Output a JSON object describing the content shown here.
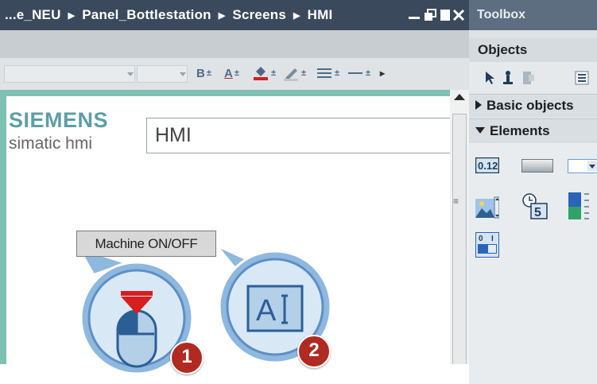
{
  "editor": {
    "breadcrumb": [
      "...e_NEU",
      "Panel_Bottlestation",
      "Screens",
      "HMI"
    ],
    "window_controls": [
      "minimize",
      "restore",
      "maximize",
      "close"
    ]
  },
  "format_toolbar": {
    "bold_label": "B",
    "font_color_label": "A",
    "overflow_glyph": "▸"
  },
  "screen": {
    "logo_text": "SIEMENS",
    "subtitle": "simatic hmi",
    "title_field_value": "HMI",
    "button_label": "Machine ON/OFF"
  },
  "callouts": [
    {
      "number": "1",
      "icon": "mouse-icon"
    },
    {
      "number": "2",
      "icon": "text-field-icon"
    }
  ],
  "toolbox": {
    "title": "Toolbox",
    "objects_header": "Objects",
    "basic_objects": "Basic objects",
    "elements": "Elements",
    "elements_items": [
      "io-field-icon",
      "button-icon",
      "symbolic-io-field-icon",
      "graphic-io-field-icon",
      "date-time-field-icon",
      "bar-icon",
      "switch-icon"
    ],
    "io_field_label": "0.12",
    "clock_digit": "5"
  },
  "colors": {
    "titlebar": "#3a4a5c",
    "canvas_frame": "#7fc0b4",
    "siemens_teal": "#5e9ea6",
    "callout_blue": "#8fb8df",
    "badge_red": "#b02a21"
  }
}
